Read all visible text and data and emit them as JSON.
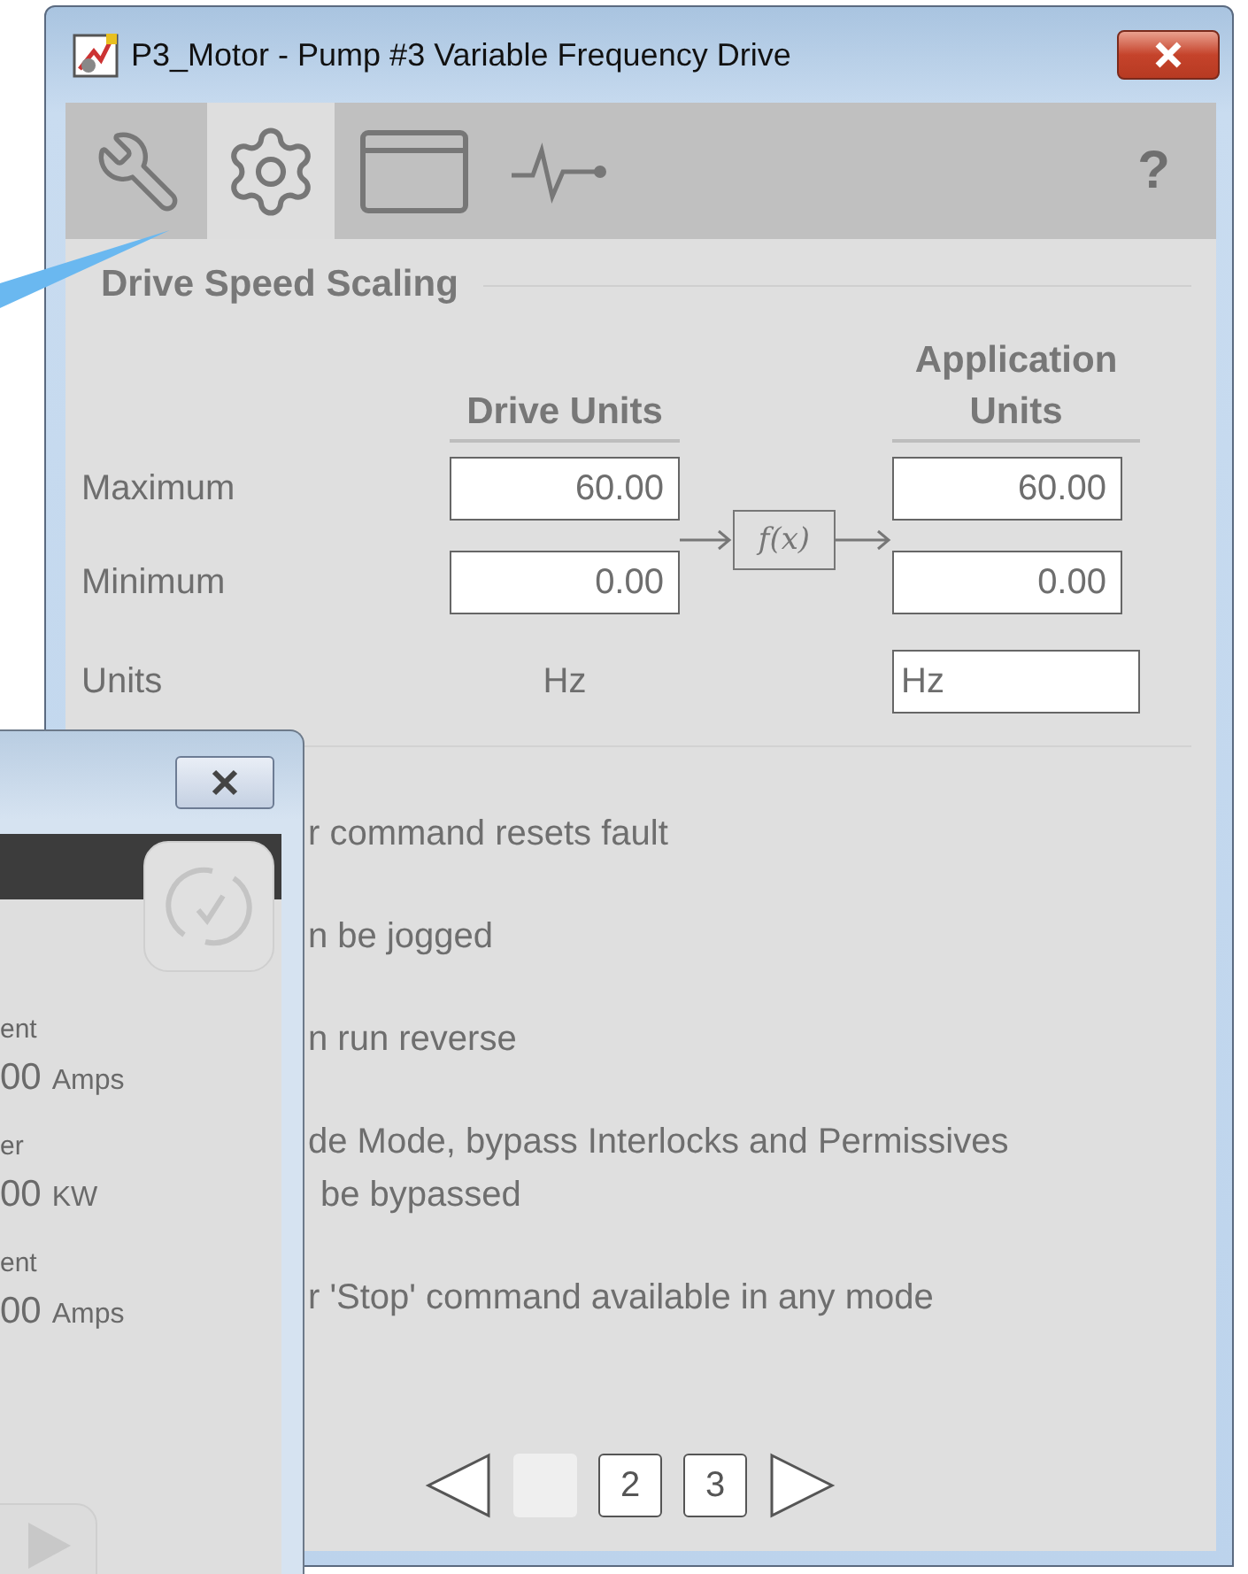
{
  "window": {
    "title": "P3_Motor - Pump #3 Variable Frequency Drive"
  },
  "toolbar": {
    "tabs": [
      {
        "kind": "wrench",
        "selected": false
      },
      {
        "kind": "gear",
        "selected": true
      },
      {
        "kind": "faceplate",
        "selected": false
      },
      {
        "kind": "trend",
        "selected": false
      }
    ],
    "help": "?"
  },
  "section": {
    "title": "Drive Speed Scaling"
  },
  "scaling": {
    "columns": [
      "Drive Units",
      "Application Units"
    ],
    "function": "f(x)",
    "rows": [
      {
        "label": "Maximum",
        "drive": "60.00",
        "app": "60.00"
      },
      {
        "label": "Minimum",
        "drive": "0.00",
        "app": "0.00"
      }
    ],
    "units": {
      "label": "Units",
      "drive": "Hz",
      "app": "Hz"
    }
  },
  "options": [
    {
      "lines": [
        "r command resets fault"
      ]
    },
    {
      "lines": [
        "n be jogged"
      ]
    },
    {
      "lines": [
        "n run reverse"
      ]
    },
    {
      "lines": [
        "de Mode, bypass Interlocks and Permissives",
        "be bypassed"
      ]
    },
    {
      "lines": [
        "r 'Stop' command available in any mode"
      ]
    }
  ],
  "pager": {
    "pages": [
      {
        "selected": true
      },
      {
        "label": "2",
        "selected": false
      },
      {
        "label": "3",
        "selected": false
      }
    ]
  },
  "popup": {
    "items": [
      {
        "label": "ent",
        "value": "00",
        "unit": "Amps"
      },
      {
        "label": "er",
        "value": "00",
        "unit": "KW"
      },
      {
        "label": "ent",
        "value": "00",
        "unit": "Amps"
      }
    ]
  }
}
